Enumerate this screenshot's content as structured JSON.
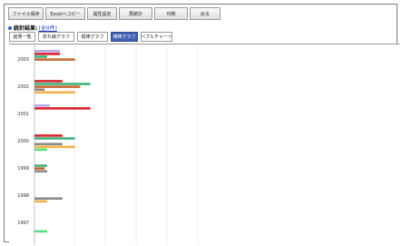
{
  "toolbar": {
    "buttons": [
      "ファイル保存",
      "Excelへコピー",
      "属性設定",
      "再統計",
      "印刷",
      "戻る"
    ]
  },
  "result": {
    "title": "統計結果:",
    "link": "(全0件)"
  },
  "tabs": [
    "結果一覧",
    "折れ線グラフ",
    "縦棒グラフ",
    "横棒グラフ",
    "バブルチャート"
  ],
  "active_tab_index": 3,
  "chart_data": {
    "type": "bar",
    "orientation": "horizontal",
    "categories": [
      "2003",
      "2002",
      "2001",
      "2000",
      "1999",
      "1998",
      "1997"
    ],
    "series_colors": [
      "#b7a6ea",
      "#d8242e",
      "#3fb27f",
      "#c86a31",
      "#8a8a8a",
      "#f2b24a",
      "#56e07a"
    ],
    "values": [
      [
        10,
        10,
        5,
        16,
        0,
        0,
        0
      ],
      [
        0,
        11,
        22,
        18,
        4,
        16,
        0
      ],
      [
        6,
        22,
        0,
        0,
        0,
        0,
        0
      ],
      [
        0,
        11,
        16,
        0,
        11,
        16,
        5
      ],
      [
        0,
        0,
        5,
        4,
        5,
        0,
        0
      ],
      [
        0,
        0,
        0,
        0,
        11,
        5,
        0
      ],
      [
        0,
        0,
        0,
        0,
        0,
        0,
        5
      ]
    ],
    "grid": true
  }
}
